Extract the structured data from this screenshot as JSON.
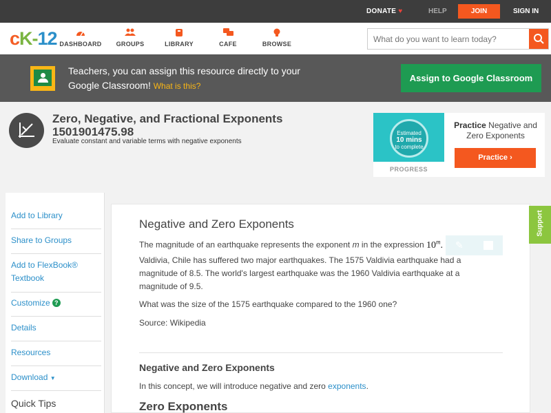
{
  "topbar": {
    "donate": "DONATE",
    "help": "HELP",
    "join": "JOIN",
    "sign_in": "SIGN IN"
  },
  "nav": {
    "logo": {
      "c": "c",
      "dash": "K-",
      "num": "12"
    },
    "items": [
      {
        "label": "DASHBOARD",
        "icon": "dashboard-icon"
      },
      {
        "label": "GROUPS",
        "icon": "groups-icon"
      },
      {
        "label": "LIBRARY",
        "icon": "library-icon"
      },
      {
        "label": "CAFE",
        "icon": "cafe-icon"
      },
      {
        "label": "BROWSE",
        "icon": "browse-icon"
      }
    ],
    "search_placeholder": "What do you want to learn today?"
  },
  "classroom": {
    "text": "Teachers, you can assign this resource directly to your Google Classroom!",
    "what": "What is this?",
    "button": "Assign to Google Classroom"
  },
  "concept": {
    "title": "Zero, Negative, and Fractional Exponents",
    "id": "1501901475.98",
    "subtitle": "Evaluate constant and variable terms with negative exponents"
  },
  "practice": {
    "estimated": "Estimated",
    "mins": "10 mins",
    "complete": "to complete",
    "progress": "PROGRESS",
    "label_bold": "Practice",
    "label_rest": "Negative and Zero Exponents",
    "button": "Practice"
  },
  "sidebar": {
    "items": [
      {
        "label": "Add to Library"
      },
      {
        "label": "Share to Groups"
      },
      {
        "label": "Add to FlexBook® Textbook"
      },
      {
        "label": "Customize"
      },
      {
        "label": "Details"
      },
      {
        "label": "Resources"
      },
      {
        "label": "Download"
      }
    ],
    "quick_tips": "Quick Tips"
  },
  "article": {
    "title": "Negative and Zero Exponents",
    "p1_before": "The magnitude of an earthquake represents the exponent",
    "p1_var": "m",
    "p1_after": "in the expression",
    "p1_math_base": "10",
    "p1_math_exp": "m",
    "p2": "Valdivia, Chile has suffered two major earthquakes. The 1575 Valdivia earthquake had a magnitude of 8.5. The world's largest earthquake was the 1960 Valdivia earthquake at a magnitude of 9.5.",
    "p3": "What was the size of the 1575 earthquake compared to the 1960 one?",
    "p4": "Source: Wikipedia",
    "h3": "Negative and Zero Exponents",
    "p5_before": "In this concept, we will introduce negative and zero",
    "p5_link": "exponents",
    "p5_after": ".",
    "h2": "Zero Exponents"
  },
  "support": "Support",
  "colors": {
    "accent": "#f4581f",
    "link": "#2b8fc9",
    "green": "#1e9b52",
    "support": "#8cc63f"
  }
}
